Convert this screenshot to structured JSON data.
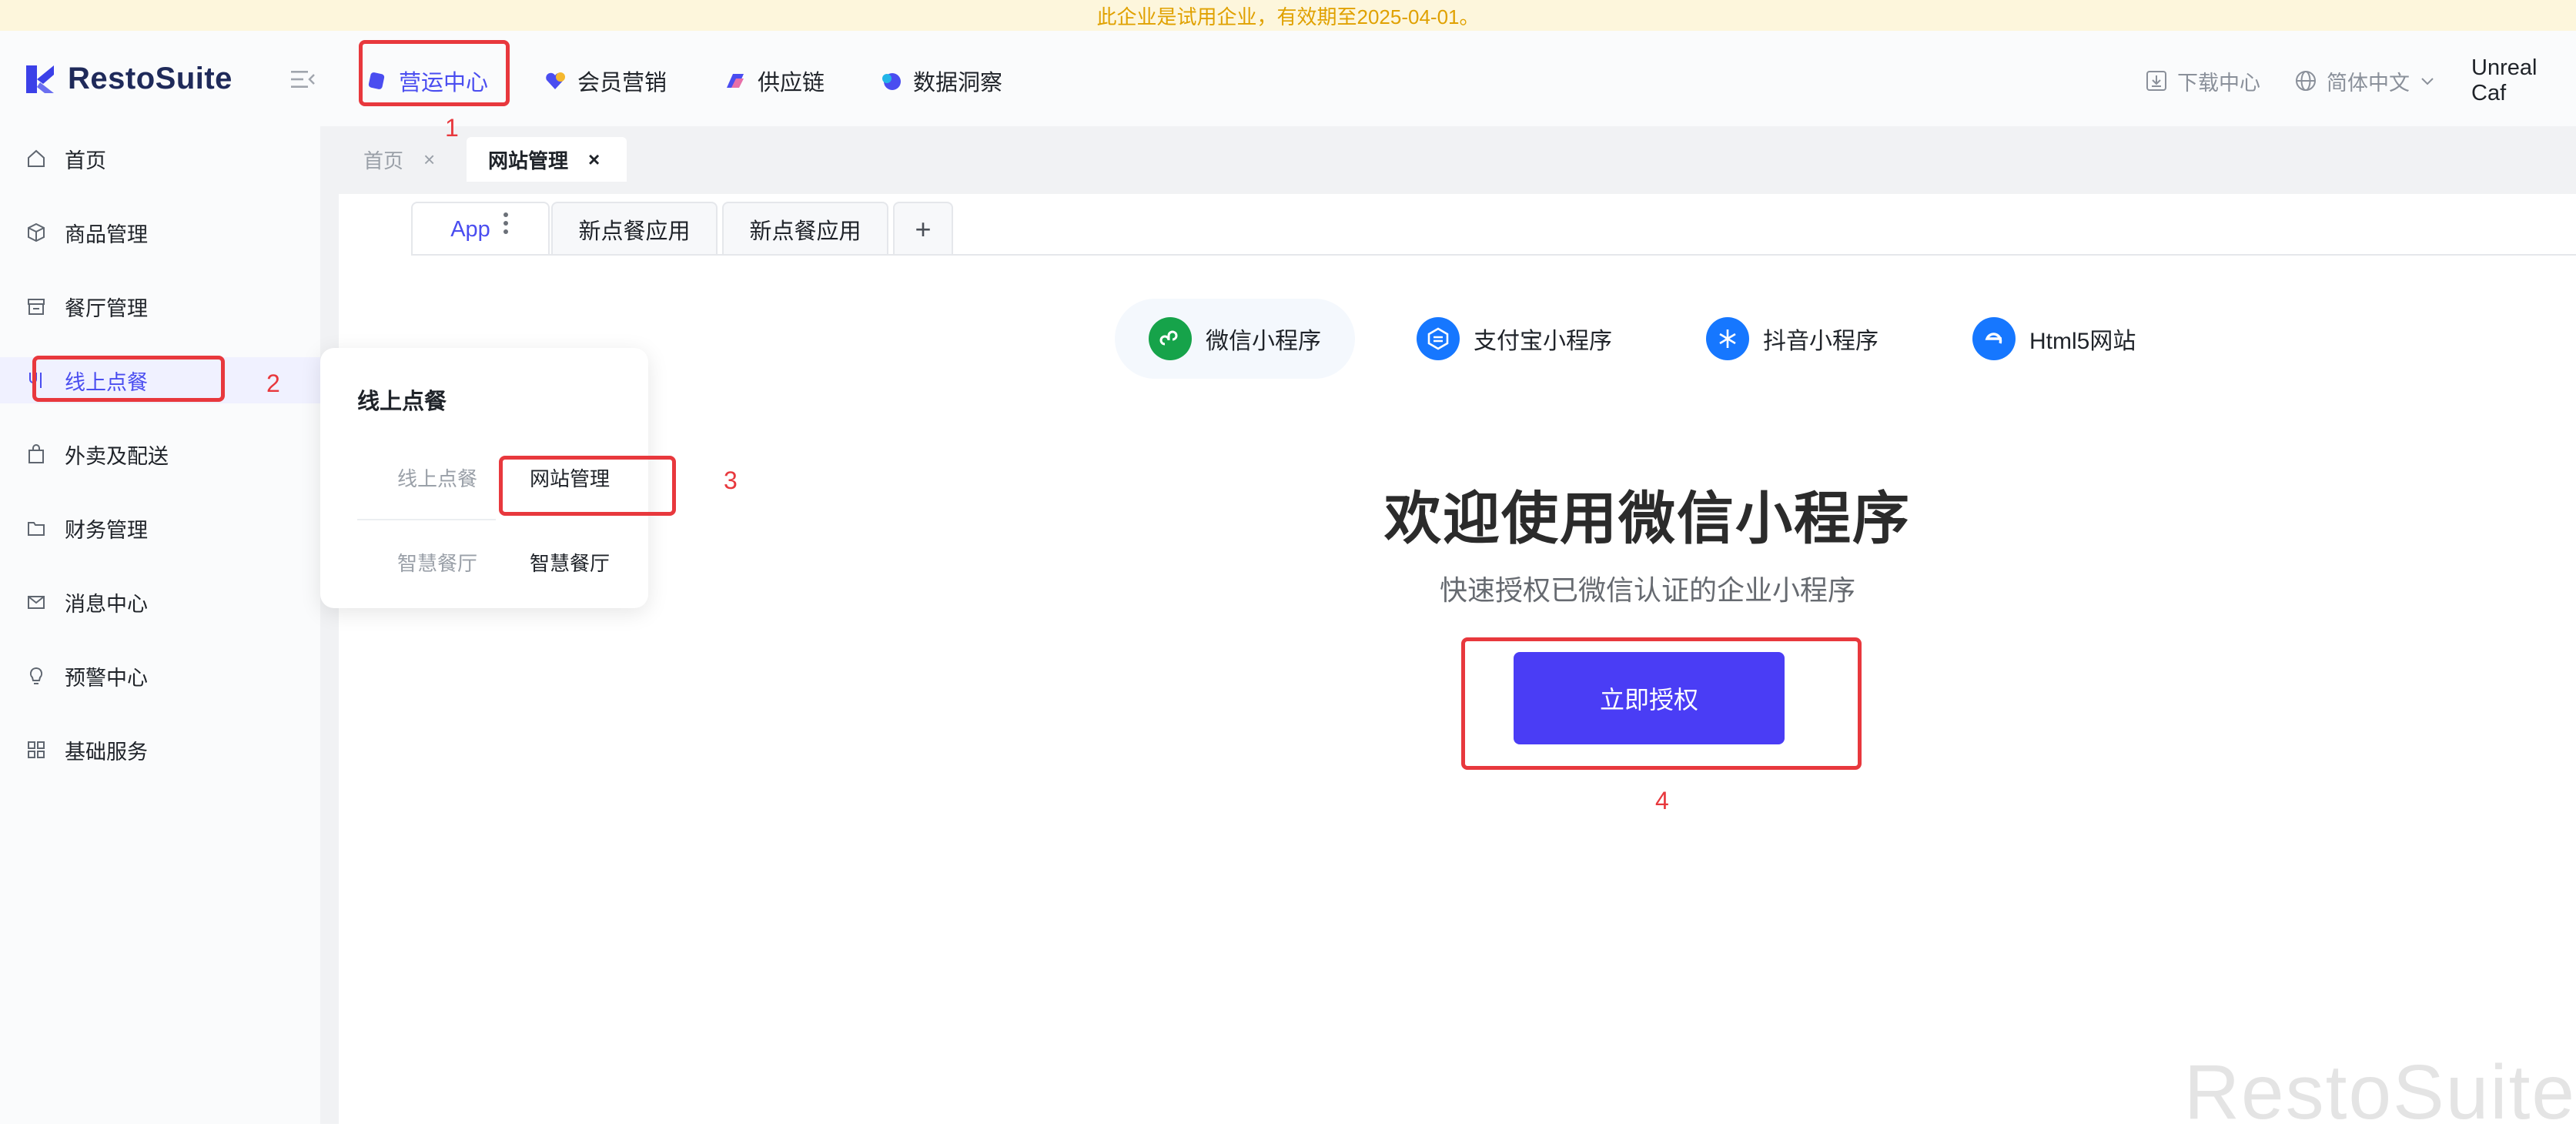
{
  "trial_banner": "此企业是试用企业，有效期至2025-04-01。",
  "brand": {
    "name": "RestoSuite"
  },
  "top_nav": {
    "items": [
      {
        "label": "营运中心",
        "icon": "ops-center-icon",
        "active": true
      },
      {
        "label": "会员营销",
        "icon": "member-marketing-icon",
        "active": false
      },
      {
        "label": "供应链",
        "icon": "supply-chain-icon",
        "active": false
      },
      {
        "label": "数据洞察",
        "icon": "data-insight-icon",
        "active": false
      }
    ],
    "download_center": "下载中心",
    "language": "简体中文",
    "user": "Unreal Caf"
  },
  "sidebar": {
    "items": [
      {
        "label": "首页",
        "icon": "home-icon"
      },
      {
        "label": "商品管理",
        "icon": "box-icon"
      },
      {
        "label": "餐厅管理",
        "icon": "store-icon"
      },
      {
        "label": "线上点餐",
        "icon": "online-order-icon",
        "active": true
      },
      {
        "label": "外卖及配送",
        "icon": "bag-icon"
      },
      {
        "label": "财务管理",
        "icon": "folder-icon"
      },
      {
        "label": "消息中心",
        "icon": "mail-icon"
      },
      {
        "label": "预警中心",
        "icon": "bulb-icon"
      },
      {
        "label": "基础服务",
        "icon": "grid-icon"
      }
    ]
  },
  "page_tabs": [
    {
      "label": "首页",
      "close": "×"
    },
    {
      "label": "网站管理",
      "close": "×"
    }
  ],
  "app_tabs": {
    "items": [
      "App",
      "新点餐应用",
      "新点餐应用"
    ],
    "add": "+"
  },
  "channels": [
    {
      "label": "微信小程序",
      "icon": "wechat-mini-icon",
      "color": "#16a34a",
      "selected": true
    },
    {
      "label": "支付宝小程序",
      "icon": "alipay-icon",
      "color": "#1677ff"
    },
    {
      "label": "抖音小程序",
      "icon": "douyin-icon",
      "color": "#1677ff"
    },
    {
      "label": "Html5网站",
      "icon": "html5-ie-icon",
      "color": "#1677ff"
    }
  ],
  "hero": {
    "title": "欢迎使用微信小程序",
    "subtitle": "快速授权已微信认证的企业小程序",
    "button": "立即授权"
  },
  "popover": {
    "title": "线上点餐",
    "rows": [
      {
        "category": "线上点餐",
        "link": "网站管理"
      },
      {
        "category": "智慧餐厅",
        "link": "智慧餐厅"
      }
    ]
  },
  "annotations": [
    "1",
    "2",
    "3",
    "4"
  ],
  "watermark": "RestoSuite",
  "colors": {
    "accent": "#4a4df0",
    "button": "#4a3df5",
    "annotation": "#e8383d",
    "banner_text": "#e0a100"
  }
}
